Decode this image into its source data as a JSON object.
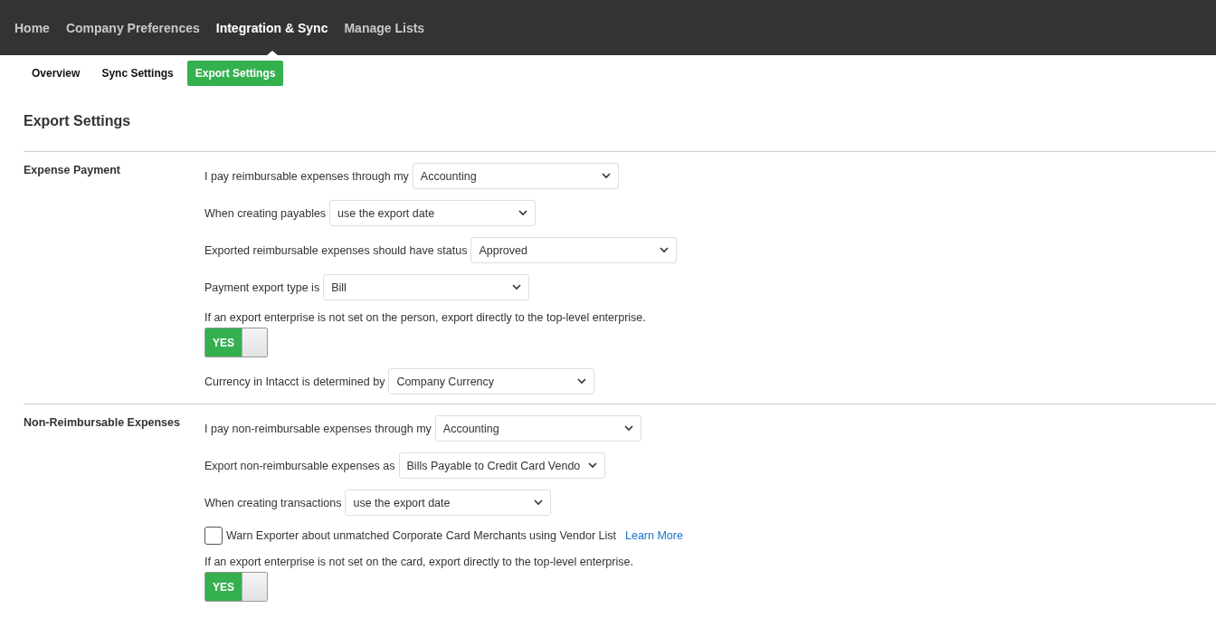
{
  "top_nav": [
    {
      "label": "Home",
      "selected": false
    },
    {
      "label": "Company Preferences",
      "selected": false
    },
    {
      "label": "Integration & Sync",
      "selected": true
    },
    {
      "label": "Manage Lists",
      "selected": false
    }
  ],
  "sub_tabs": [
    {
      "label": "Overview",
      "selected": false
    },
    {
      "label": "Sync Settings",
      "selected": false
    },
    {
      "label": "Export Settings",
      "selected": true
    }
  ],
  "page_title": "Export Settings",
  "sections": [
    {
      "title": "Expense Payment",
      "rows": [
        {
          "kind": "select",
          "label": "I pay reimbursable expenses through my",
          "value": "Accounting"
        },
        {
          "kind": "select",
          "label": "When creating payables",
          "value": "use the export date"
        },
        {
          "kind": "select",
          "label": "Exported reimbursable expenses should have status",
          "value": "Approved"
        },
        {
          "kind": "select",
          "label": "Payment export type is",
          "value": "Bill"
        },
        {
          "kind": "toggle",
          "label": "If an export enterprise is not set on the person, export directly to the top-level enterprise.",
          "on": true,
          "state_text": "YES"
        },
        {
          "kind": "select",
          "label": "Currency in Intacct is determined by",
          "value": "Company Currency"
        }
      ]
    },
    {
      "title": "Non-Reimbursable Expenses",
      "rows": [
        {
          "kind": "select",
          "label": "I pay non-reimbursable expenses through my",
          "value": "Accounting"
        },
        {
          "kind": "select",
          "label": "Export non-reimbursable expenses as",
          "value": "Bills Payable to Credit Card Vendo"
        },
        {
          "kind": "select",
          "label": "When creating transactions",
          "value": "use the export date"
        },
        {
          "kind": "checkbox",
          "label": "Warn Exporter about unmatched Corporate Card Merchants using Vendor List",
          "checked": false,
          "link": "Learn More"
        },
        {
          "kind": "toggle",
          "label": "If an export enterprise is not set on the card, export directly to the top-level enterprise.",
          "on": true,
          "state_text": "YES"
        }
      ]
    }
  ]
}
